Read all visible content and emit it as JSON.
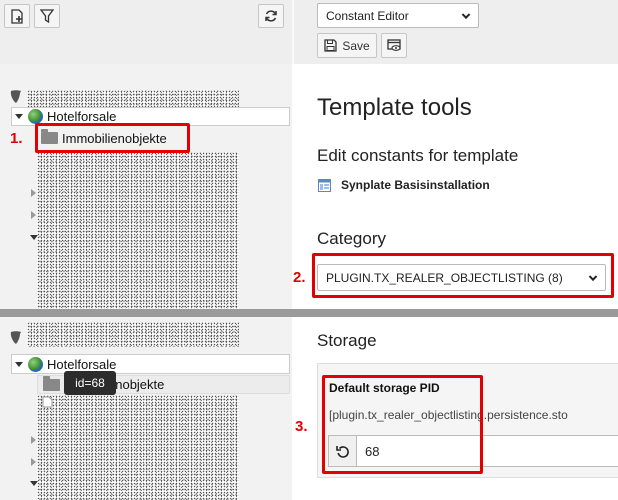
{
  "toolbar": {
    "editor_select": "Constant Editor",
    "save_label": "Save"
  },
  "steps": [
    "1.",
    "2.",
    "3."
  ],
  "tree": {
    "root_label": "Hotelforsale",
    "child_label": "Immobilienobjekte",
    "child_label_partial": "enobjekte",
    "tooltip": "id=68"
  },
  "main": {
    "title": "Template tools",
    "subtitle": "Edit constants for template",
    "template_name": "Synplate Basisinstallation",
    "category_heading": "Category",
    "category_value": "PLUGIN.TX_REALER_OBJECTLISTING (8)",
    "storage_heading": "Storage",
    "storage_label": "Default storage PID",
    "storage_constant": "[plugin.tx_realer_objectlisting.persistence.sto",
    "storage_value": "68"
  },
  "colors": {
    "annotation_red": "#e40000",
    "left_panel_bg": "#f2f2f2",
    "toolbar_bg": "#eeeeee"
  }
}
